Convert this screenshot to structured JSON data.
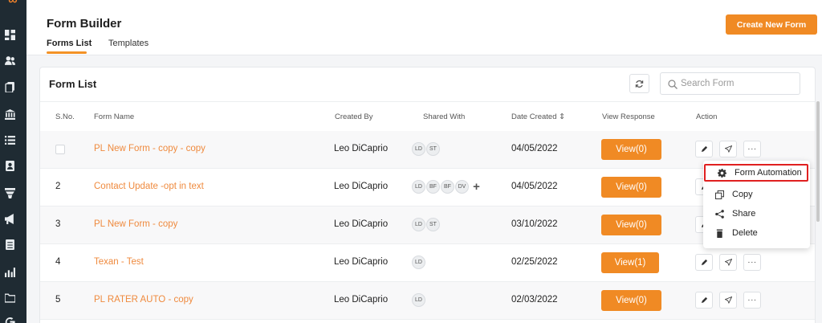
{
  "sidebar": {
    "logo_text": "∞",
    "icons": [
      "dashboard-icon",
      "contacts-icon",
      "documents-icon",
      "bank-icon",
      "list-icon",
      "contact-card-icon",
      "funnel-icon",
      "megaphone-icon",
      "notes-icon",
      "analytics-icon",
      "folder-icon",
      "google-icon"
    ]
  },
  "header": {
    "title": "Form Builder",
    "tabs": [
      {
        "label": "Forms List",
        "active": true
      },
      {
        "label": "Templates",
        "active": false
      }
    ],
    "create_button_label": "Create New Form"
  },
  "form_list": {
    "title": "Form List",
    "search_placeholder": "Search Form",
    "columns": {
      "sno": "S.No.",
      "form_name": "Form Name",
      "created_by": "Created By",
      "shared_with": "Shared With",
      "date_created": "Date Created ⇕",
      "view_response": "View Response",
      "action": "Action"
    },
    "rows": [
      {
        "sno": "",
        "name": "PL New Form - copy - copy",
        "created_by": "Leo DiCaprio",
        "shared": [
          "LD",
          "ST"
        ],
        "shared_add": "",
        "date": "04/05/2022",
        "view": "View(0)"
      },
      {
        "sno": "2",
        "name": "Contact Update -opt in text",
        "created_by": "Leo DiCaprio",
        "shared": [
          "LD",
          "BF",
          "BF",
          "DV"
        ],
        "shared_add": "+",
        "date": "04/05/2022",
        "view": "View(0)"
      },
      {
        "sno": "3",
        "name": "PL New Form - copy",
        "created_by": "Leo DiCaprio",
        "shared": [
          "LD",
          "ST"
        ],
        "shared_add": "",
        "date": "03/10/2022",
        "view": "View(0)"
      },
      {
        "sno": "4",
        "name": "Texan - Test",
        "created_by": "Leo DiCaprio",
        "shared": [
          "LD"
        ],
        "shared_add": "",
        "date": "02/25/2022",
        "view": "View(1)"
      },
      {
        "sno": "5",
        "name": "PL RATER AUTO - copy",
        "created_by": "Leo DiCaprio",
        "shared": [
          "LD"
        ],
        "shared_add": "",
        "date": "02/03/2022",
        "view": "View(0)"
      }
    ],
    "action_more_label": "···"
  },
  "dropdown": {
    "items": [
      {
        "label": "Form Automation",
        "icon": "gear-icon",
        "highlighted": true
      },
      {
        "label": "Copy",
        "icon": "copy-icon",
        "highlighted": false
      },
      {
        "label": "Share",
        "icon": "share-icon",
        "highlighted": false
      },
      {
        "label": "Delete",
        "icon": "trash-icon",
        "highlighted": false
      }
    ]
  },
  "colors": {
    "accent": "#f08a24",
    "link": "#ef8a3e",
    "sidebar": "#1f2b33",
    "highlight_border": "#e02020"
  }
}
